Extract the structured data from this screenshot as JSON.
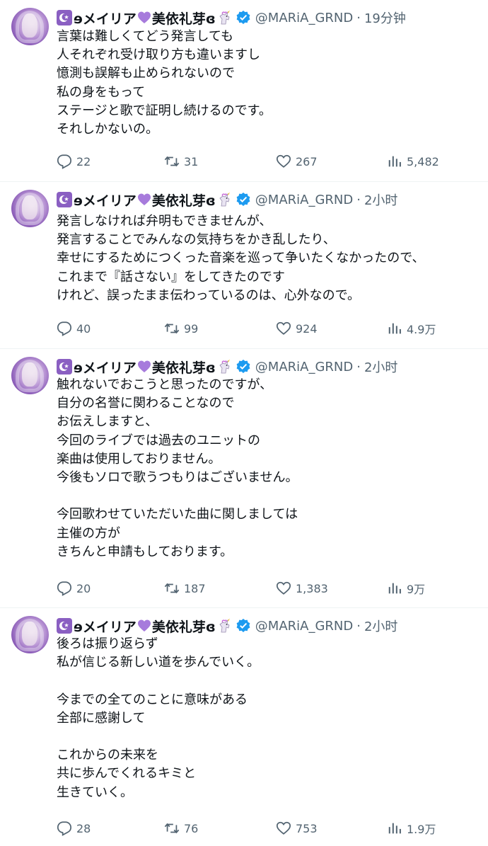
{
  "user": {
    "display_name": "ɘメイリア💜美依礼芽ɞ",
    "name_part1": "ɘメイリア",
    "name_part2": "美依礼芽ɞ",
    "handle": "@MARiA_GRND"
  },
  "tweets": [
    {
      "time": "19分钟",
      "text": "言葉は難しくてどう発言しても\n人それぞれ受け取り方も違いますし\n憶測も誤解も止められないので\n私の身をもって\nステージと歌で証明し続けるのです。\nそれしかないの。",
      "reply_count": "22",
      "retweet_count": "31",
      "like_count": "267",
      "view_count": "5,482"
    },
    {
      "time": "2小时",
      "text": "発言しなければ弁明もできませんが、\n発言することでみんなの気持ちをかき乱したり、\n幸せにするためにつくった音楽を巡って争いたくなかったので、\nこれまで『話さない』をしてきたのです\nけれど、誤ったまま伝わっているのは、心外なので。",
      "reply_count": "40",
      "retweet_count": "99",
      "like_count": "924",
      "view_count": "4.9万"
    },
    {
      "time": "2小时",
      "text": "触れないでおこうと思ったのですが、\n自分の名誉に関わることなので\nお伝えしますと、\n今回のライブでは過去のユニットの\n楽曲は使用しておりません。\n今後もソロで歌うつもりはございません。\n\n今回歌わせていただいた曲に関しましては\n主催の方が\nきちんと申請もしております。",
      "reply_count": "20",
      "retweet_count": "187",
      "like_count": "1,383",
      "view_count": "9万"
    },
    {
      "time": "2小时",
      "text": "後ろは振り返らず\n私が信じる新しい道を歩んでいく。\n\n今までの全てのことに意味がある\n全部に感謝して\n\nこれからの未来を\n共に歩んでくれるキミと\n生きていく。",
      "reply_count": "28",
      "retweet_count": "76",
      "like_count": "753",
      "view_count": "1.9万"
    }
  ],
  "colors": {
    "text": "#0f1419",
    "secondary": "#536471",
    "verified": "#1d9bf0",
    "divider": "#eff3f4",
    "heart_emoji": "#a77bdc",
    "moon_badge": "#8a5fc2"
  },
  "icons": {
    "reply": "reply-icon",
    "retweet": "retweet-icon",
    "like": "heart-icon",
    "views": "views-icon",
    "verified": "verified-badge-icon"
  }
}
